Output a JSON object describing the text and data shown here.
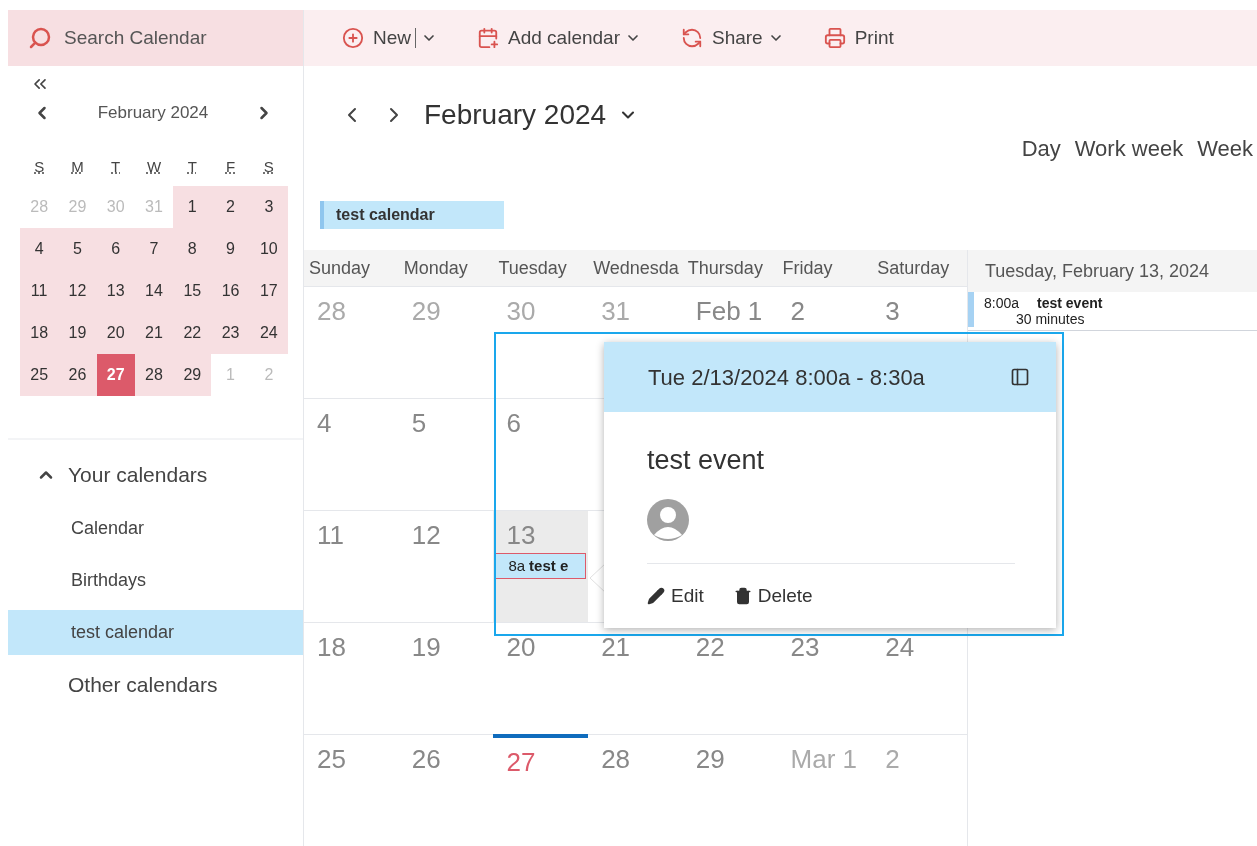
{
  "search": {
    "placeholder": "Search Calendar"
  },
  "toolbar": [
    {
      "kind": "new",
      "label": "New",
      "split": true
    },
    {
      "kind": "add",
      "label": "Add calendar",
      "split": false
    },
    {
      "kind": "share",
      "label": "Share",
      "split": false
    },
    {
      "kind": "print",
      "label": "Print",
      "split": false
    }
  ],
  "mini_calendar": {
    "month": "February 2024",
    "weekdays": [
      "S",
      "M",
      "T",
      "W",
      "T",
      "F",
      "S"
    ],
    "weeks": [
      [
        {
          "label": "28",
          "in_month": false,
          "today": false
        },
        {
          "label": "29",
          "in_month": false,
          "today": false
        },
        {
          "label": "30",
          "in_month": false,
          "today": false
        },
        {
          "label": "31",
          "in_month": false,
          "today": false
        },
        {
          "label": "1",
          "in_month": true,
          "today": false
        },
        {
          "label": "2",
          "in_month": true,
          "today": false
        },
        {
          "label": "3",
          "in_month": true,
          "today": false
        }
      ],
      [
        {
          "label": "4",
          "in_month": true,
          "today": false
        },
        {
          "label": "5",
          "in_month": true,
          "today": false
        },
        {
          "label": "6",
          "in_month": true,
          "today": false
        },
        {
          "label": "7",
          "in_month": true,
          "today": false
        },
        {
          "label": "8",
          "in_month": true,
          "today": false
        },
        {
          "label": "9",
          "in_month": true,
          "today": false
        },
        {
          "label": "10",
          "in_month": true,
          "today": false
        }
      ],
      [
        {
          "label": "11",
          "in_month": true,
          "today": false
        },
        {
          "label": "12",
          "in_month": true,
          "today": false
        },
        {
          "label": "13",
          "in_month": true,
          "today": false
        },
        {
          "label": "14",
          "in_month": true,
          "today": false
        },
        {
          "label": "15",
          "in_month": true,
          "today": false
        },
        {
          "label": "16",
          "in_month": true,
          "today": false
        },
        {
          "label": "17",
          "in_month": true,
          "today": false
        }
      ],
      [
        {
          "label": "18",
          "in_month": true,
          "today": false
        },
        {
          "label": "19",
          "in_month": true,
          "today": false
        },
        {
          "label": "20",
          "in_month": true,
          "today": false
        },
        {
          "label": "21",
          "in_month": true,
          "today": false
        },
        {
          "label": "22",
          "in_month": true,
          "today": false
        },
        {
          "label": "23",
          "in_month": true,
          "today": false
        },
        {
          "label": "24",
          "in_month": true,
          "today": false
        }
      ],
      [
        {
          "label": "25",
          "in_month": true,
          "today": false
        },
        {
          "label": "26",
          "in_month": true,
          "today": false
        },
        {
          "label": "27",
          "in_month": true,
          "today": true
        },
        {
          "label": "28",
          "in_month": true,
          "today": false
        },
        {
          "label": "29",
          "in_month": true,
          "today": false
        },
        {
          "label": "1",
          "in_month": false,
          "today": false
        },
        {
          "label": "2",
          "in_month": false,
          "today": false
        }
      ]
    ]
  },
  "sidebar": {
    "group": {
      "label": "Your calendars",
      "expanded": true,
      "items": [
        {
          "label": "Calendar",
          "selected": false
        },
        {
          "label": "Birthdays",
          "selected": false
        },
        {
          "label": "test calendar",
          "selected": true
        }
      ]
    },
    "other_label": "Other calendars"
  },
  "header": {
    "month": "February 2024",
    "views": [
      "Day",
      "Work week",
      "Week"
    ]
  },
  "calendar_legend": [
    {
      "label": "test calendar",
      "color": "#c2e7fa"
    }
  ],
  "grid": {
    "weekdays": [
      "Sunday",
      "Monday",
      "Tuesday",
      "Wednesda",
      "Thursday",
      "Friday",
      "Saturday"
    ],
    "weeks": [
      [
        {
          "label": "28",
          "in_month": false,
          "today": false,
          "selected": false
        },
        {
          "label": "29",
          "in_month": false,
          "today": false,
          "selected": false
        },
        {
          "label": "30",
          "in_month": false,
          "today": false,
          "selected": false
        },
        {
          "label": "31",
          "in_month": false,
          "today": false,
          "selected": false
        },
        {
          "label": "Feb 1",
          "in_month": true,
          "today": false,
          "selected": false
        },
        {
          "label": "2",
          "in_month": true,
          "today": false,
          "selected": false
        },
        {
          "label": "3",
          "in_month": true,
          "today": false,
          "selected": false
        }
      ],
      [
        {
          "label": "4",
          "in_month": true,
          "today": false,
          "selected": false
        },
        {
          "label": "5",
          "in_month": true,
          "today": false,
          "selected": false
        },
        {
          "label": "6",
          "in_month": true,
          "today": false,
          "selected": false
        }
      ],
      [
        {
          "label": "11",
          "in_month": true,
          "today": false,
          "selected": false
        },
        {
          "label": "12",
          "in_month": true,
          "today": false,
          "selected": false
        },
        {
          "label": "13",
          "in_month": true,
          "today": false,
          "selected": true,
          "events": [
            {
              "time": "8a",
              "title": "test e",
              "selected": true
            }
          ]
        }
      ],
      [
        {
          "label": "18",
          "in_month": true,
          "today": false,
          "selected": false
        },
        {
          "label": "19",
          "in_month": true,
          "today": false,
          "selected": false
        },
        {
          "label": "20",
          "in_month": true,
          "today": false,
          "selected": false
        },
        {
          "label": "21",
          "in_month": true,
          "today": false,
          "selected": false
        },
        {
          "label": "22",
          "in_month": true,
          "today": false,
          "selected": false
        },
        {
          "label": "23",
          "in_month": true,
          "today": false,
          "selected": false
        },
        {
          "label": "24",
          "in_month": true,
          "today": false,
          "selected": false
        }
      ],
      [
        {
          "label": "25",
          "in_month": true,
          "today": false,
          "selected": false
        },
        {
          "label": "26",
          "in_month": true,
          "today": false,
          "selected": false
        },
        {
          "label": "27",
          "in_month": true,
          "today": true,
          "selected": false
        },
        {
          "label": "28",
          "in_month": true,
          "today": false,
          "selected": false
        },
        {
          "label": "29",
          "in_month": true,
          "today": false,
          "selected": false
        },
        {
          "label": "Mar 1",
          "in_month": false,
          "today": false,
          "selected": false
        },
        {
          "label": "2",
          "in_month": false,
          "today": false,
          "selected": false
        }
      ]
    ]
  },
  "agenda": {
    "date": "Tuesday, February 13, 2024",
    "events": [
      {
        "time": "8:00a",
        "title": "test event",
        "duration": "30 minutes"
      }
    ]
  },
  "popup": {
    "when": "Tue 2/13/2024 8:00a - 8:30a",
    "title": "test event",
    "actions": [
      {
        "kind": "edit",
        "label": "Edit"
      },
      {
        "kind": "delete",
        "label": "Delete"
      }
    ]
  }
}
